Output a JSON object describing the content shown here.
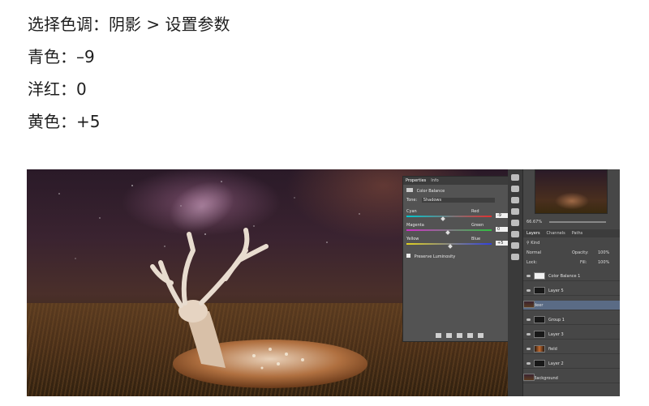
{
  "instructions": {
    "line1": "选择色调：阴影 > 设置参数",
    "line2": "青色：–9",
    "line3": "洋红：0",
    "line4": "黄色：+5"
  },
  "properties_panel": {
    "tabs": [
      "Properties",
      "Info"
    ],
    "adjustment_title": "Color Balance",
    "tone_label": "Tone:",
    "tone_value": "Shadows",
    "sliders": [
      {
        "left": "Cyan",
        "right": "Red",
        "value": "-9",
        "color_left": "#00c8d0",
        "color_right": "#e23030",
        "position": 0.45
      },
      {
        "left": "Magenta",
        "right": "Green",
        "value": "0",
        "color_left": "#d030c8",
        "color_right": "#30c040",
        "position": 0.5
      },
      {
        "left": "Yellow",
        "right": "Blue",
        "value": "+5",
        "color_left": "#e0d020",
        "color_right": "#3040e0",
        "position": 0.53
      }
    ],
    "preserve_luminosity": "Preserve Luminosity"
  },
  "layers_panel": {
    "zoom": "66.67%",
    "tabs": [
      "Layers",
      "Channels",
      "Paths"
    ],
    "kind_label": "Kind",
    "blend_mode": "Normal",
    "opacity_label": "Opacity:",
    "opacity_value": "100%",
    "lock_label": "Lock:",
    "fill_label": "Fill:",
    "fill_value": "100%",
    "layers": [
      {
        "name": "Color Balance 1",
        "thumb": "white",
        "selected": false
      },
      {
        "name": "Layer 5",
        "thumb": "dark",
        "selected": false
      },
      {
        "name": "deer",
        "thumb": "scene",
        "selected": true
      },
      {
        "name": "Group 1",
        "thumb": "dark",
        "selected": false
      },
      {
        "name": "Layer 3",
        "thumb": "dark",
        "selected": false
      },
      {
        "name": "field",
        "thumb": "fire",
        "selected": false
      },
      {
        "name": "Layer 2",
        "thumb": "dark",
        "selected": false
      },
      {
        "name": "Background",
        "thumb": "scene",
        "selected": false
      }
    ]
  }
}
